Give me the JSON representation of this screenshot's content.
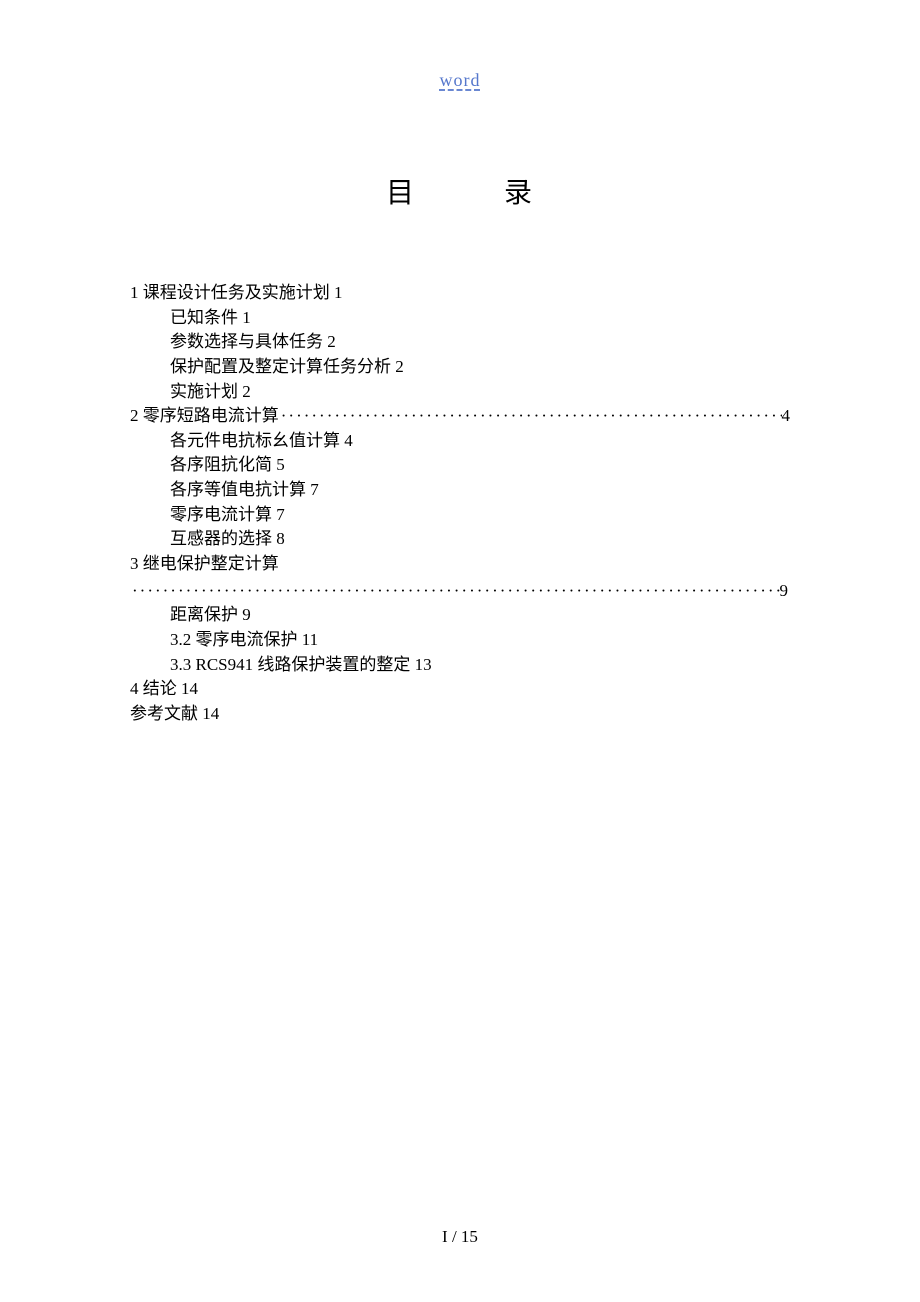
{
  "header": {
    "word_label": "word"
  },
  "title": {
    "char1": "目",
    "char2": "录"
  },
  "toc": {
    "sec1": {
      "heading": "1 课程设计任务及实施计划 1",
      "items": [
        "已知条件 1",
        "参数选择与具体任务 2",
        "保护配置及整定计算任务分析 2",
        "实施计划 2"
      ]
    },
    "sec2": {
      "heading_prefix": "2 零序短路电流计算",
      "heading_page": "4",
      "items": [
        "各元件电抗标幺值计算 4",
        "各序阻抗化简 5",
        "各序等值电抗计算 7",
        "零序电流计算 7",
        "互感器的选择 8"
      ]
    },
    "sec3": {
      "heading": "3 继电保护整定计算",
      "dotted_page": " 9",
      "items": [
        "距离保护 9",
        "3.2 零序电流保护 11",
        "3.3 RCS941 线路保护装置的整定 13"
      ]
    },
    "sec4": "4 结论 14",
    "refs": "参考文献 14"
  },
  "footer": {
    "page_label": "I / 15"
  }
}
